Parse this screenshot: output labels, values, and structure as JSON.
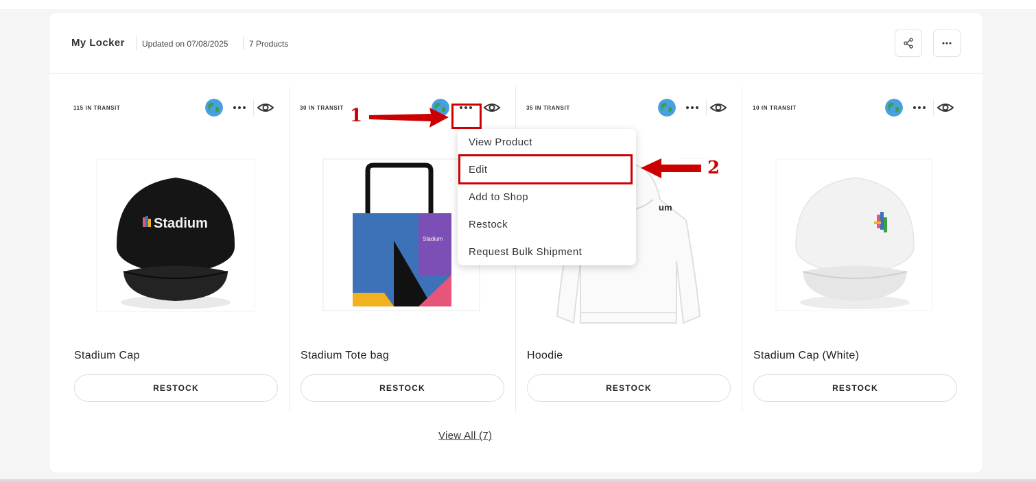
{
  "locker": {
    "title": "My Locker",
    "updated": "Updated on 07/08/2025",
    "count": "7 Products"
  },
  "header_icons": [
    "share-icon",
    "more-icon"
  ],
  "products": [
    {
      "transit": "115 IN TRANSIT",
      "name": "Stadium Cap",
      "restock": "RESTOCK",
      "image": "black-cap"
    },
    {
      "transit": "30 IN TRANSIT",
      "name": "Stadium Tote bag",
      "restock": "RESTOCK",
      "image": "tote-bag"
    },
    {
      "transit": "35 IN TRANSIT",
      "name": "Hoodie",
      "restock": "RESTOCK",
      "image": "white-hoodie"
    },
    {
      "transit": "10 IN TRANSIT",
      "name": "Stadium Cap (White)",
      "restock": "RESTOCK",
      "image": "white-cap"
    }
  ],
  "brand_text": "Stadium",
  "hoodie_fragment": "um",
  "menu": {
    "items": [
      "View Product",
      "Edit",
      "Add to Shop",
      "Restock",
      "Request Bulk Shipment"
    ]
  },
  "view_all": "View All (7)",
  "annotations": {
    "step1": "1",
    "step2": "2"
  },
  "colors": {
    "highlight": "#cc0000",
    "accent_blue": "#3e72b8",
    "accent_purple": "#7b4fb5",
    "accent_pink": "#e5567a",
    "accent_yellow": "#f0b21e"
  }
}
